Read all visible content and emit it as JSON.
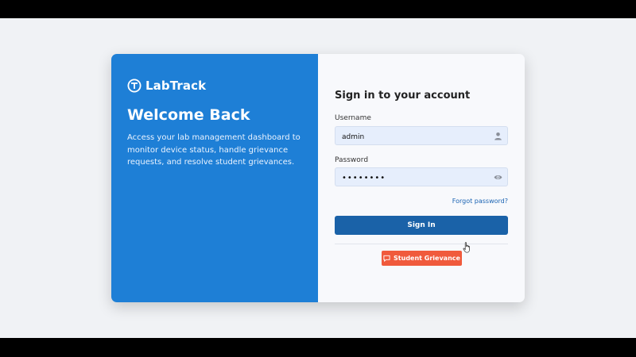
{
  "brand": {
    "name": "LabTrack",
    "logo": "lab-logo-icon"
  },
  "hero": {
    "title": "Welcome Back",
    "description": "Access your lab management dashboard to monitor device status, handle grievance requests, and resolve student grievances."
  },
  "login": {
    "heading": "Sign in to your account",
    "username_label": "Username",
    "username_value": "admin",
    "password_label": "Password",
    "password_value": "password",
    "forgot_label": "Forgot password?",
    "signin_label": "Sign In",
    "grievance_label": "Student Grievance"
  },
  "icons": {
    "username": "user-icon",
    "password": "eye-icon",
    "grievance": "chat-icon"
  },
  "colors": {
    "panel_blue": "#1e7fd6",
    "signin_button": "#1a62a8",
    "grievance_button": "#f05a3c",
    "link": "#1a63b3"
  }
}
